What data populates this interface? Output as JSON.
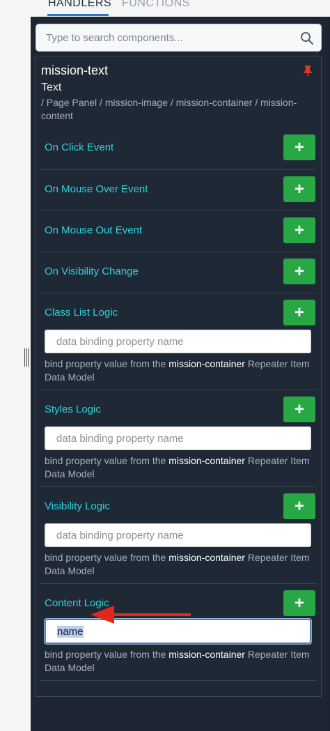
{
  "tabs": {
    "handlers": "HANDLERS",
    "functions": "FUNCTIONS"
  },
  "search": {
    "placeholder": "Type to search components..."
  },
  "component": {
    "name": "mission-text",
    "type": "Text",
    "path": "/ Page Panel / mission-image / mission-container / mission-content"
  },
  "sections": {
    "on_click": {
      "label": "On Click Event"
    },
    "on_mouse_over": {
      "label": "On Mouse Over Event"
    },
    "on_mouse_out": {
      "label": "On Mouse Out Event"
    },
    "on_visibility_change": {
      "label": "On Visibility Change"
    },
    "class_list": {
      "label": "Class List Logic",
      "placeholder": "data binding property name",
      "value": "",
      "help_prefix": "bind property value from the ",
      "help_bold": "mission-container",
      "help_suffix": " Repeater Item Data Model"
    },
    "styles": {
      "label": "Styles Logic",
      "placeholder": "data binding property name",
      "value": "",
      "help_prefix": "bind property value from the ",
      "help_bold": "mission-container",
      "help_suffix": " Repeater Item Data Model"
    },
    "visibility": {
      "label": "Visibility Logic",
      "placeholder": "data binding property name",
      "value": "",
      "help_prefix": "bind property value from the ",
      "help_bold": "mission-container",
      "help_suffix": " Repeater Item Data Model"
    },
    "content": {
      "label": "Content Logic",
      "value": "name",
      "help_prefix": "bind property value from the ",
      "help_bold": "mission-container",
      "help_suffix": " Repeater Item Data Model"
    }
  },
  "add_button": {
    "symbol": "+"
  },
  "colors": {
    "accent": "#2fd3e0",
    "add_button": "#28a745",
    "pin": "#e0382b",
    "arrow": "#e3261a"
  },
  "icons": {
    "search": "search-icon",
    "pin": "pin-icon",
    "plus": "plus-icon",
    "arrow": "red-arrow-annotation"
  }
}
